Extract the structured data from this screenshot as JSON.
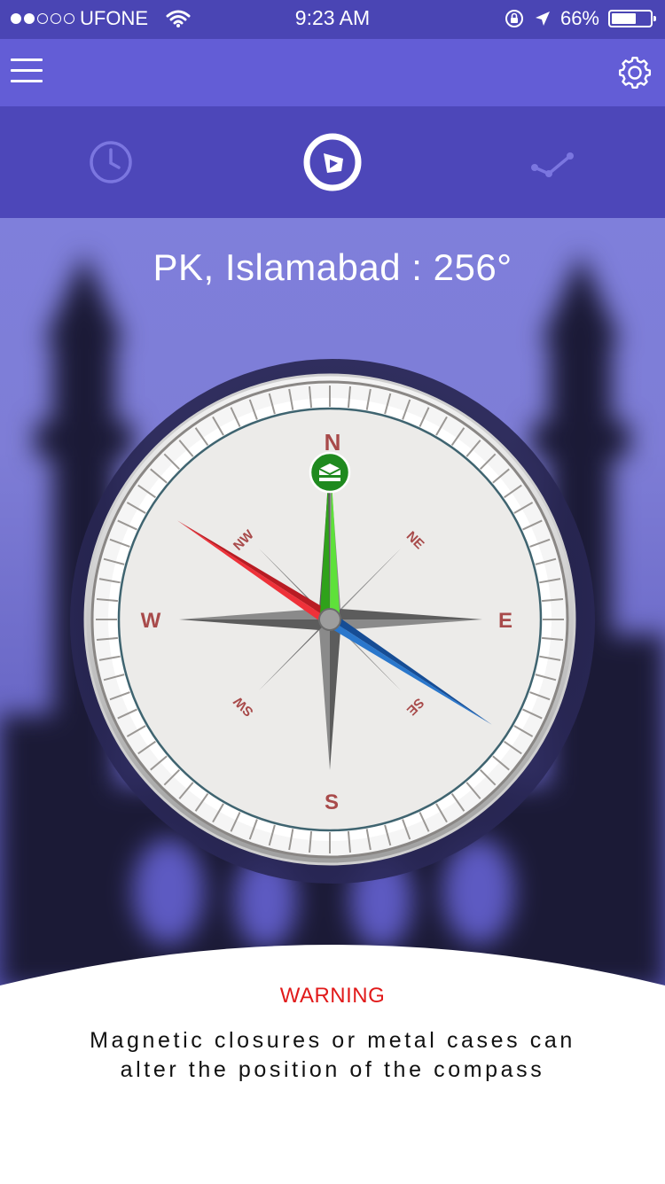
{
  "status_bar": {
    "carrier": "UFONE",
    "time": "9:23 AM",
    "battery": "66%",
    "battery_level": 0.66,
    "signal_bars_filled": 2,
    "signal_bars_total": 5
  },
  "top_bar": {
    "menu_icon": "hamburger-menu-icon",
    "settings_icon": "gear-icon"
  },
  "tabs": [
    {
      "icon": "clock-icon",
      "active": false
    },
    {
      "icon": "qibla-compass-icon",
      "active": true
    },
    {
      "icon": "trend-line-icon",
      "active": false
    }
  ],
  "compass": {
    "location_label": "PK, Islamabad : 256°",
    "heading_degrees": 256,
    "cardinals": {
      "n": "N",
      "e": "E",
      "s": "S",
      "w": "W",
      "ne": "NE",
      "se": "SE",
      "sw": "SW",
      "nw": "NW"
    },
    "kaaba_icon": "kaaba-icon",
    "colors": {
      "qibla_needle": "#3cc21e",
      "north_needle": "#e8262e",
      "south_needle": "#1d63b8",
      "cardinal_text": "#a84a4a",
      "face": "#ecebe9"
    }
  },
  "warning": {
    "title": "WARNING",
    "line1": "Magnetic closures or metal cases can",
    "line2": "alter the position of the compass",
    "title_color": "#e11a1a"
  }
}
